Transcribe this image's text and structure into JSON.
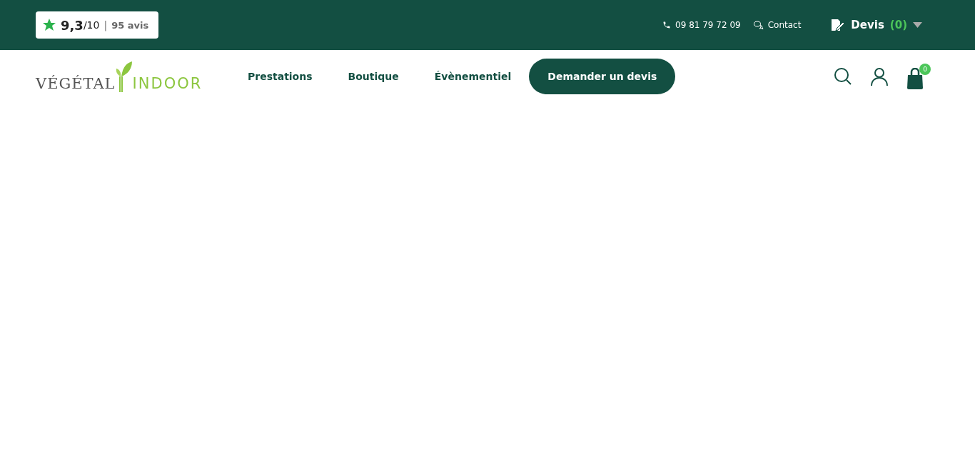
{
  "topbar": {
    "rating": {
      "score": "9,3",
      "scale": "/10",
      "separator": "|",
      "reviews": "95 avis"
    },
    "phone": "09 81 79 72 09",
    "contact": "Contact",
    "quote": {
      "label": "Devis",
      "count": "(0)"
    }
  },
  "header": {
    "logo": {
      "first": "VÉGÉTAL",
      "second": "INDOOR"
    },
    "nav": [
      {
        "label": "Prestations",
        "kind": "link"
      },
      {
        "label": "Boutique",
        "kind": "link"
      },
      {
        "label": "Évènementiel",
        "kind": "link"
      },
      {
        "label": "Demander un devis",
        "kind": "cta"
      }
    ],
    "cart_count": "0"
  }
}
